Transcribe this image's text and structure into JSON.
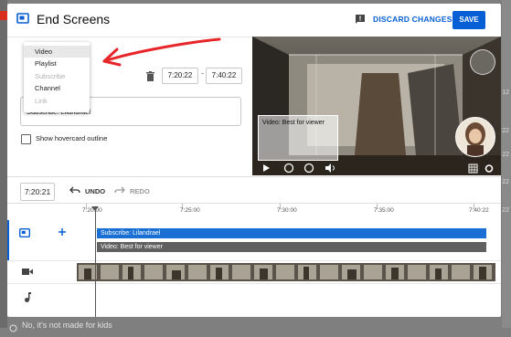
{
  "header": {
    "title": "End Screens",
    "discard_label": "DISCARD CHANGES",
    "save_label": "SAVE"
  },
  "element_type_menu": {
    "items": [
      {
        "label": "Video",
        "selected": true,
        "disabled": false
      },
      {
        "label": "Playlist",
        "selected": false,
        "disabled": false
      },
      {
        "label": "Subscribe",
        "selected": false,
        "disabled": true
      },
      {
        "label": "Channel",
        "selected": false,
        "disabled": false
      },
      {
        "label": "Link",
        "selected": false,
        "disabled": true
      }
    ]
  },
  "element_timing": {
    "start": "7:20:22",
    "separator": "-",
    "end": "7:40:22"
  },
  "element_field": {
    "value": "Subscribe: Lilandrael"
  },
  "hovercard": {
    "label": "Show hovercard outline",
    "checked": false
  },
  "preview": {
    "card_label": "Video: Best for viewer"
  },
  "timeline": {
    "playhead_time": "7:20:21",
    "undo_label": "UNDO",
    "redo_label": "REDO",
    "ruler_labels": [
      "7:20:00",
      "7:25:00",
      "7:30:00",
      "7:35:00",
      "7:40:22"
    ],
    "elements": [
      {
        "label": "Subscribe: Lilandrael",
        "color": "#1a6fd4"
      },
      {
        "label": "Video: Best for viewer",
        "color": "#606060"
      }
    ]
  },
  "background": {
    "bottom_text": "No, it's not made for kids",
    "right_numbers": [
      "12",
      "22",
      "22",
      "22",
      "22"
    ]
  },
  "colors": {
    "accent": "#065fd4",
    "annotation_arrow": "#e8262a"
  }
}
